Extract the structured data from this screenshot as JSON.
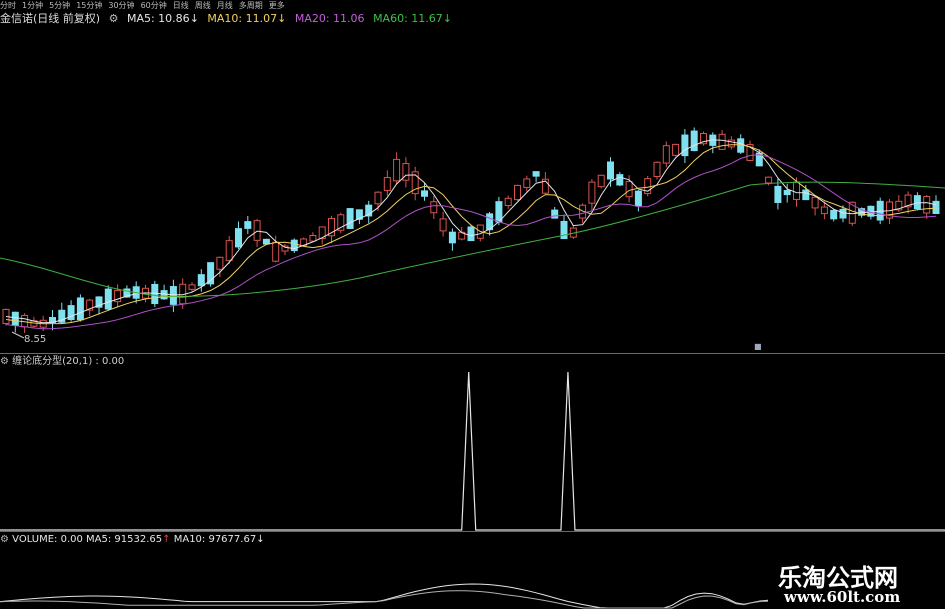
{
  "toolbar": {
    "items": [
      "分时",
      "1分钟",
      "5分钟",
      "15分钟",
      "30分钟",
      "60分钟",
      "日线",
      "周线",
      "月线",
      "多周期",
      "更多"
    ]
  },
  "main_panel": {
    "title": "金信诺(日线 前复权)",
    "ma5": "MA5: 10.86",
    "ma10": "MA10: 11.07",
    "ma20": "MA20: 11.06",
    "ma60": "MA60: 11.67",
    "down_arrow": "↓",
    "low_label": "8.55",
    "marker_glyph": "■"
  },
  "indicator_panel": {
    "title": "缠论底分型(20,1) : 0.00"
  },
  "volume_panel": {
    "label": "VOLUME: 0.00",
    "ma5": "MA5: 91532.65",
    "ma10": "MA10: 97677.67",
    "up_arrow": "↑",
    "down_arrow": "↓"
  },
  "watermark": {
    "title": "乐淘公式网",
    "url": "www.60lt.com"
  },
  "colors": {
    "background": "#000000",
    "up_candle": "#d9534f",
    "down_candle": "#7fe0f0",
    "ma5": "#e6e6e6",
    "ma10": "#f0d060",
    "ma20": "#b050c8",
    "ma60": "#3fb040"
  },
  "chart_data": [
    {
      "type": "candlestick",
      "title": "金信诺(日线 前复权)",
      "series": [
        {
          "name": "MA5",
          "values": [
            10.86
          ]
        },
        {
          "name": "MA10",
          "values": [
            11.07
          ]
        },
        {
          "name": "MA20",
          "values": [
            11.06
          ]
        },
        {
          "name": "MA60",
          "values": [
            11.67
          ]
        }
      ],
      "annotations": [
        "8.55"
      ]
    },
    {
      "type": "line",
      "title": "缠论底分型(20,1) : 0.00",
      "series": [
        {
          "name": "缠论底分型",
          "spike_positions": [
            0.496,
            0.601
          ]
        }
      ]
    },
    {
      "type": "line",
      "title": "VOLUME: 0.00",
      "series": [
        {
          "name": "MA5",
          "values": [
            91532.65
          ]
        },
        {
          "name": "MA10",
          "values": [
            97677.67
          ]
        }
      ]
    }
  ]
}
